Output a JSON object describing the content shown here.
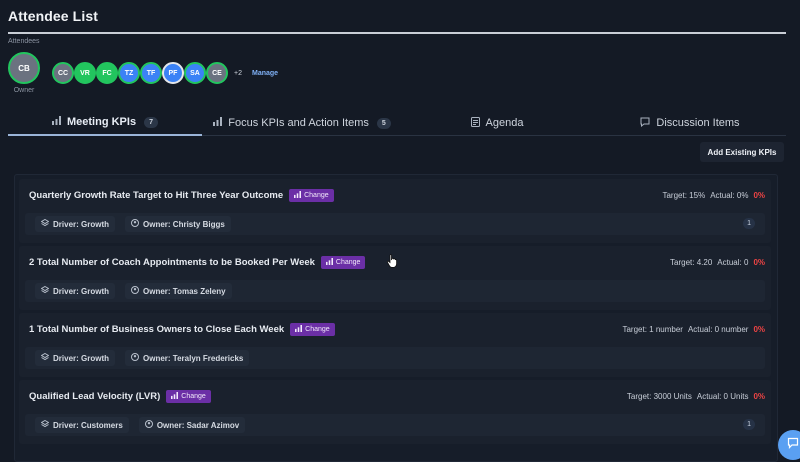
{
  "header": {
    "title": "Attendee List"
  },
  "attendees": {
    "label": "Attendees",
    "owner": {
      "initials": "CB",
      "role_label": "Owner"
    },
    "members": [
      {
        "initials": "CC",
        "color": "#6b7280"
      },
      {
        "initials": "VR",
        "color": "#22c55e"
      },
      {
        "initials": "FC",
        "color": "#22c55e"
      },
      {
        "initials": "TZ",
        "color": "#3b82f6"
      },
      {
        "initials": "TF",
        "color": "#3b82f6"
      },
      {
        "initials": "PF",
        "color": "#3b82f6"
      },
      {
        "initials": "SA",
        "color": "#3b82f6"
      },
      {
        "initials": "CE",
        "color": "#6b7280"
      }
    ],
    "more": "+2",
    "manage_label": "Manage"
  },
  "tabs": [
    {
      "label": "Meeting KPIs",
      "count": "7",
      "icon": "bar-chart-icon"
    },
    {
      "label": "Focus KPIs and Action Items",
      "count": "5",
      "icon": "bar-chart-icon"
    },
    {
      "label": "Agenda",
      "icon": "document-icon"
    },
    {
      "label": "Discussion Items",
      "icon": "chat-icon"
    }
  ],
  "actions": {
    "add_existing_kpis": "Add Existing KPIs"
  },
  "kpis": [
    {
      "title": "Quarterly Growth Rate Target to Hit Three Year Outcome",
      "change_label": "Change",
      "target": "Target: 15%",
      "actual": "Actual: 0%",
      "percent": "0%",
      "driver": "Driver: Growth",
      "owner": "Owner: Christy Biggs",
      "count": "1"
    },
    {
      "title": "2 Total Number of Coach Appointments to be Booked Per Week",
      "change_label": "Change",
      "target": "Target: 4.20",
      "actual": "Actual: 0",
      "percent": "0%",
      "driver": "Driver: Growth",
      "owner": "Owner: Tomas Zeleny",
      "count": ""
    },
    {
      "title": "1 Total Number of Business Owners to Close Each Week",
      "change_label": "Change",
      "target": "Target: 1 number",
      "actual": "Actual: 0 number",
      "percent": "0%",
      "driver": "Driver: Growth",
      "owner": "Owner: Teralyn Fredericks",
      "count": ""
    },
    {
      "title": "Qualified Lead Velocity (LVR)",
      "change_label": "Change",
      "target": "Target: 3000 Units",
      "actual": "Actual: 0 Units",
      "percent": "0%",
      "driver": "Driver: Customers",
      "owner": "Owner: Sadar Azimov",
      "count": "1"
    }
  ],
  "colors": {
    "accent": "#5aa0f2",
    "change_badge": "#6b2fa6",
    "negative": "#ef4444",
    "owner_ring": "#22c55e"
  }
}
